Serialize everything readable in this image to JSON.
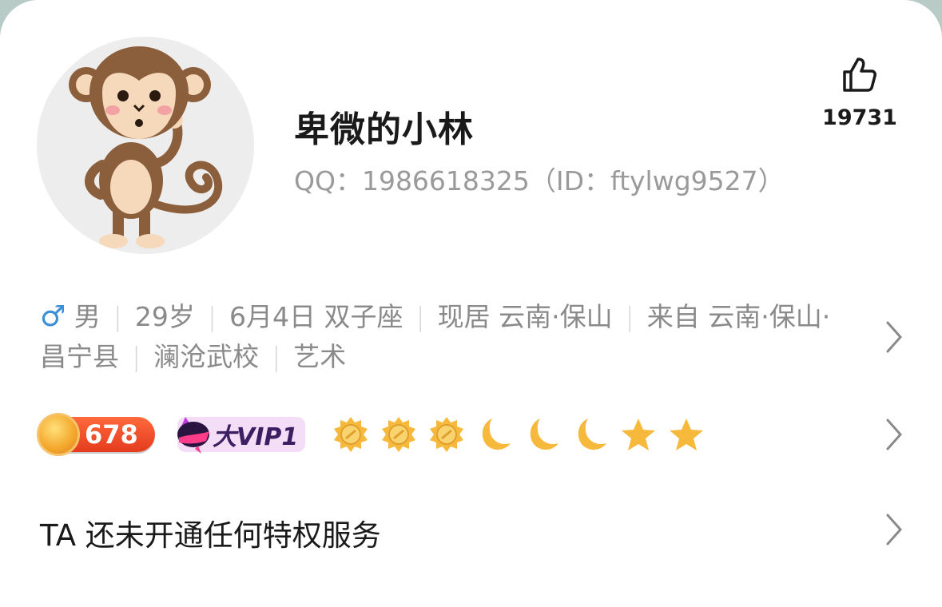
{
  "profile": {
    "nickname": "卑微的小林",
    "qq_line": "QQ：1986618325（ID：ftylwg9527）",
    "avatar_icon": "monkey-avatar"
  },
  "like": {
    "icon": "thumbs-up-icon",
    "count": "19731"
  },
  "info": {
    "gender_icon": "male-icon",
    "gender": "男",
    "age": "29岁",
    "birthday": "6月4日 双子座",
    "residence": "现居 云南·保山",
    "hometown": "来自 云南·保山·昌宁县",
    "school": "澜沧武校",
    "occupation": "艺术"
  },
  "badges": {
    "level_value": "678",
    "vip_label": "大VIP1",
    "level_icons": [
      "sun",
      "sun",
      "sun",
      "moon",
      "moon",
      "moon",
      "star",
      "star"
    ]
  },
  "privilege": {
    "text": "TA 还未开通任何特权服务"
  },
  "colors": {
    "male": "#3b8fd6",
    "secondary_text": "#8a8a8a",
    "level_badge": "#e9472a",
    "vip_bg": "#f3ddf7"
  }
}
